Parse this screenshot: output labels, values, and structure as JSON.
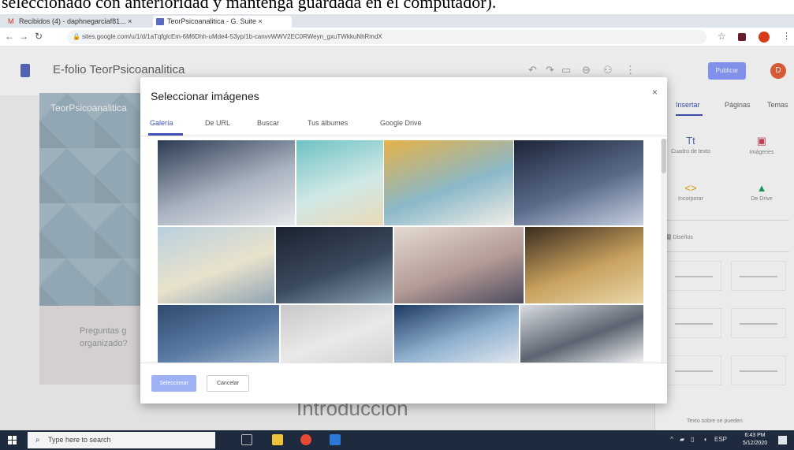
{
  "caption": "seleccionado con anterioridad y mantenga guardada en el computador).",
  "browser": {
    "tabs": [
      {
        "label": "Recibidos (4) - daphnegarciaf81... ×",
        "active": false
      },
      {
        "label": "TeorPsicoanalitica - G. Suite ×",
        "active": true
      }
    ],
    "new_tab": "+",
    "url": "sites.google.com/u/1/d/1aTqfglcEm-6M6Dhh-uMde4-53yp/1b-canvvWWV2EC0RWeyn_gxuTWkkuNhRmdX",
    "min": "–",
    "max": "▫",
    "close": "×"
  },
  "sites": {
    "title": "E-folio TeorPsicoanalitica",
    "publish_label": "Publicar",
    "avatar_letter": "D",
    "hero_title": "TeorPsicoanalitica",
    "band_text_line1": "Preguntas g",
    "band_text_line2": "organizado?",
    "intro": "Introduccion"
  },
  "right_panel": {
    "tabs": [
      "Insertar",
      "Páginas",
      "Temas"
    ],
    "items": [
      {
        "label": "Cuadro de texto",
        "icon": "Tt"
      },
      {
        "label": "Imágenes",
        "icon": "▣"
      },
      {
        "label": "Incorporar",
        "icon": "<>"
      },
      {
        "label": "De Drive",
        "icon": "▲"
      }
    ],
    "layouts_label": "Diseños",
    "footer": "Texto sobre se pueden"
  },
  "dialog": {
    "title": "Seleccionar imágenes",
    "close": "×",
    "tabs": [
      "Galería",
      "De URL",
      "Buscar",
      "Tus álbumes",
      "Google Drive"
    ],
    "active_tab": 0,
    "select_label": "Seleccionar",
    "cancel_label": "Cancelar",
    "images": [
      {
        "name": "diagonal-lines",
        "colors": [
          "#2b3b52",
          "#a9b3c0",
          "#e7e9ec"
        ]
      },
      {
        "name": "turquoise-sea",
        "colors": [
          "#6ec2c3",
          "#cfe8e6",
          "#e9d9b8"
        ]
      },
      {
        "name": "colorful-fabric",
        "colors": [
          "#e7b248",
          "#8ab8c8",
          "#f1eee8"
        ]
      },
      {
        "name": "night-lake",
        "colors": [
          "#1c2538",
          "#5a6b8a",
          "#c7d1e0"
        ]
      },
      {
        "name": "clouds-sky",
        "colors": [
          "#b9d0de",
          "#e9e2cc",
          "#8fa4b3"
        ]
      },
      {
        "name": "keyboard-keys",
        "colors": [
          "#1b2230",
          "#3a4a5d",
          "#8aa0b2"
        ]
      },
      {
        "name": "misty-horizon",
        "colors": [
          "#e3dad2",
          "#b39a95",
          "#4d4a5e"
        ]
      },
      {
        "name": "golden-blur",
        "colors": [
          "#3a2c1f",
          "#c9a15e",
          "#e8d7a8"
        ]
      },
      {
        "name": "blue-water",
        "colors": [
          "#2e4a6e",
          "#5a7aa3",
          "#9fb6cf"
        ]
      },
      {
        "name": "grey-fog",
        "colors": [
          "#c8c8c8",
          "#e9e9e9",
          "#d3d3d3"
        ]
      },
      {
        "name": "blue-waves",
        "colors": [
          "#1d3a63",
          "#8fb0cf",
          "#dfe6ee"
        ]
      },
      {
        "name": "mixing-desk",
        "colors": [
          "#d9dde2",
          "#5b6470",
          "#f1f2f4"
        ]
      }
    ]
  },
  "taskbar": {
    "search_placeholder": "Type here to search",
    "time": "6:43 PM",
    "date": "5/12/2020"
  }
}
